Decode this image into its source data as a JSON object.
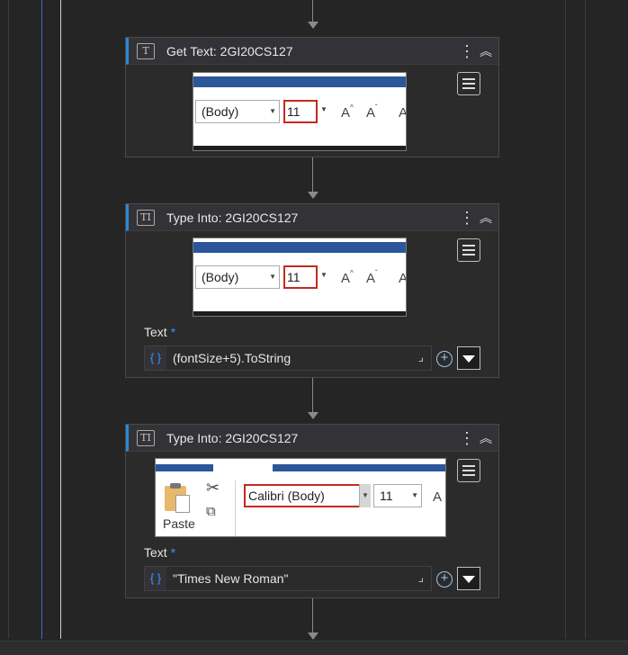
{
  "activities": [
    {
      "title": "Get Text: 2GI20CS127",
      "icon": "get-text-icon",
      "icon_glyph": "T",
      "screenshot": {
        "font_combo": "(Body)",
        "font_size": "11"
      }
    },
    {
      "title": "Type Into: 2GI20CS127",
      "icon": "type-into-icon",
      "icon_glyph": "TI",
      "screenshot": {
        "font_combo": "(Body)",
        "font_size": "11"
      },
      "text_label": "Text",
      "required_mark": "*",
      "text_value": "(fontSize+5).ToString",
      "brace": "{ }"
    },
    {
      "title": "Type Into: 2GI20CS127",
      "icon": "type-into-icon",
      "icon_glyph": "TI",
      "screenshot": {
        "paste_label": "Paste",
        "font_combo": "Calibri (Body)",
        "font_size": "11"
      },
      "text_label": "Text",
      "required_mark": "*",
      "text_value": "\"Times New Roman\"",
      "brace": "{ }"
    }
  ],
  "colors": {
    "accent": "#2f86d6",
    "highlight": "#c42b1c",
    "ribbon": "#2b579a"
  }
}
